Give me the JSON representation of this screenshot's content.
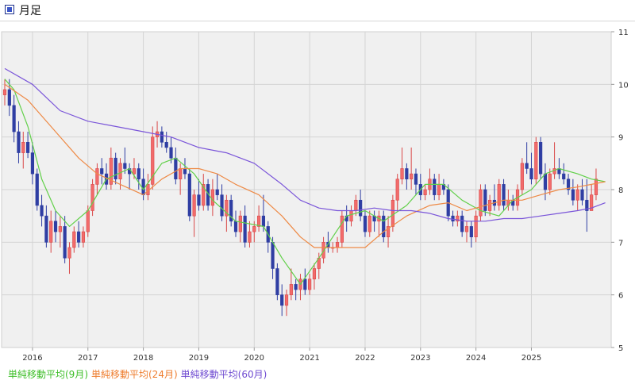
{
  "header": {
    "title": "月足",
    "icon": "chart-window-icon"
  },
  "colors": {
    "up": "#f26b6b",
    "up_border": "#d94848",
    "down": "#2f3ea3",
    "ma9": "#62d04a",
    "ma24": "#ee8a46",
    "ma60": "#7a55d9",
    "grid": "#d4d4d4",
    "plot_bg": "#f0f0f0"
  },
  "legend": [
    {
      "label": "単純移動平均(9月)",
      "color": "#3fbf2a"
    },
    {
      "label": "単純移動平均(24月)",
      "color": "#ee7d2e"
    },
    {
      "label": "単純移動平均(60月)",
      "color": "#6f4bd1"
    }
  ],
  "chart_data": {
    "type": "candlestick",
    "title": "月足",
    "ylim": [
      5,
      11
    ],
    "y_ticks": [
      5,
      6,
      7,
      8,
      9,
      10,
      11
    ],
    "y_axis_position": "right",
    "x_tick_labels": [
      "2016",
      "2017",
      "2018",
      "2019",
      "2020",
      "2021",
      "2022",
      "2023",
      "2024",
      "2025"
    ],
    "start_month": "2015-07",
    "grid": true,
    "candles": [
      [
        9.8,
        10.1,
        9.6,
        9.9
      ],
      [
        9.9,
        10.1,
        9.4,
        9.6
      ],
      [
        9.6,
        9.8,
        8.9,
        9.1
      ],
      [
        9.1,
        9.3,
        8.5,
        8.7
      ],
      [
        8.7,
        9.1,
        8.4,
        8.9
      ],
      [
        8.9,
        9.1,
        8.6,
        8.7
      ],
      [
        8.7,
        8.9,
        8.1,
        8.3
      ],
      [
        8.3,
        8.4,
        7.6,
        7.7
      ],
      [
        7.7,
        7.9,
        7.3,
        7.5
      ],
      [
        7.5,
        7.7,
        6.9,
        7.0
      ],
      [
        7.0,
        7.6,
        6.8,
        7.4
      ],
      [
        7.4,
        7.6,
        7.0,
        7.2
      ],
      [
        7.2,
        7.5,
        6.9,
        7.3
      ],
      [
        7.3,
        7.5,
        6.6,
        6.7
      ],
      [
        6.7,
        7.0,
        6.4,
        6.9
      ],
      [
        6.9,
        7.3,
        6.8,
        7.2
      ],
      [
        7.2,
        7.4,
        6.9,
        7.0
      ],
      [
        7.0,
        7.3,
        6.9,
        7.2
      ],
      [
        7.2,
        7.7,
        7.1,
        7.6
      ],
      [
        7.6,
        8.2,
        7.5,
        8.1
      ],
      [
        8.1,
        8.5,
        7.9,
        8.4
      ],
      [
        8.4,
        8.6,
        8.1,
        8.3
      ],
      [
        8.3,
        8.5,
        8.0,
        8.1
      ],
      [
        8.1,
        8.8,
        8.0,
        8.6
      ],
      [
        8.6,
        8.7,
        8.1,
        8.2
      ],
      [
        8.2,
        8.6,
        8.0,
        8.5
      ],
      [
        8.5,
        8.8,
        8.3,
        8.4
      ],
      [
        8.4,
        8.5,
        8.0,
        8.3
      ],
      [
        8.3,
        8.6,
        8.2,
        8.4
      ],
      [
        8.4,
        8.5,
        8.0,
        8.2
      ],
      [
        8.2,
        8.4,
        7.8,
        7.9
      ],
      [
        7.9,
        8.3,
        7.8,
        8.1
      ],
      [
        8.1,
        9.2,
        8.0,
        9.0
      ],
      [
        9.0,
        9.3,
        8.8,
        9.1
      ],
      [
        9.1,
        9.2,
        8.8,
        8.9
      ],
      [
        8.9,
        9.1,
        8.7,
        8.8
      ],
      [
        8.8,
        9.0,
        8.5,
        8.6
      ],
      [
        8.6,
        8.8,
        8.1,
        8.2
      ],
      [
        8.2,
        8.5,
        7.9,
        8.4
      ],
      [
        8.4,
        8.6,
        8.2,
        8.3
      ],
      [
        8.3,
        8.4,
        7.4,
        7.5
      ],
      [
        7.5,
        8.0,
        7.1,
        7.9
      ],
      [
        7.9,
        8.2,
        7.6,
        7.7
      ],
      [
        7.7,
        8.3,
        7.6,
        8.1
      ],
      [
        8.1,
        8.2,
        7.6,
        7.7
      ],
      [
        7.7,
        8.2,
        7.5,
        8.0
      ],
      [
        8.0,
        8.3,
        7.8,
        7.9
      ],
      [
        7.9,
        8.1,
        7.4,
        7.5
      ],
      [
        7.5,
        7.9,
        7.2,
        7.8
      ],
      [
        7.8,
        7.9,
        7.3,
        7.4
      ],
      [
        7.4,
        7.6,
        7.1,
        7.2
      ],
      [
        7.2,
        7.6,
        7.0,
        7.5
      ],
      [
        7.5,
        7.7,
        6.9,
        7.0
      ],
      [
        7.0,
        7.4,
        6.9,
        7.2
      ],
      [
        7.2,
        7.4,
        7.0,
        7.3
      ],
      [
        7.3,
        7.7,
        7.2,
        7.5
      ],
      [
        7.5,
        7.9,
        7.2,
        7.3
      ],
      [
        7.3,
        7.4,
        6.8,
        7.0
      ],
      [
        7.0,
        7.1,
        6.3,
        6.5
      ],
      [
        6.5,
        6.6,
        5.9,
        6.0
      ],
      [
        6.0,
        6.2,
        5.6,
        5.8
      ],
      [
        5.8,
        6.1,
        5.6,
        6.0
      ],
      [
        6.0,
        6.5,
        5.9,
        6.2
      ],
      [
        6.2,
        6.3,
        5.9,
        6.1
      ],
      [
        6.1,
        6.4,
        5.9,
        6.3
      ],
      [
        6.3,
        6.5,
        6.0,
        6.1
      ],
      [
        6.1,
        6.4,
        6.0,
        6.3
      ],
      [
        6.3,
        6.6,
        6.1,
        6.5
      ],
      [
        6.5,
        6.8,
        6.3,
        6.7
      ],
      [
        6.7,
        7.1,
        6.6,
        7.0
      ],
      [
        7.0,
        7.2,
        6.8,
        6.9
      ],
      [
        6.9,
        7.0,
        6.8,
        6.9
      ],
      [
        6.9,
        7.1,
        6.8,
        7.0
      ],
      [
        7.0,
        7.6,
        6.9,
        7.5
      ],
      [
        7.5,
        7.7,
        7.2,
        7.4
      ],
      [
        7.4,
        7.7,
        7.3,
        7.6
      ],
      [
        7.6,
        7.9,
        7.5,
        7.8
      ],
      [
        7.8,
        8.0,
        7.4,
        7.5
      ],
      [
        7.5,
        7.6,
        7.1,
        7.2
      ],
      [
        7.2,
        7.6,
        7.1,
        7.5
      ],
      [
        7.5,
        7.6,
        7.2,
        7.4
      ],
      [
        7.4,
        7.6,
        7.1,
        7.5
      ],
      [
        7.5,
        7.6,
        7.0,
        7.1
      ],
      [
        7.1,
        7.5,
        6.9,
        7.3
      ],
      [
        7.3,
        7.9,
        7.2,
        7.8
      ],
      [
        7.8,
        8.3,
        7.6,
        8.2
      ],
      [
        8.2,
        8.8,
        8.1,
        8.4
      ],
      [
        8.4,
        8.5,
        8.0,
        8.2
      ],
      [
        8.2,
        8.8,
        8.0,
        8.3
      ],
      [
        8.3,
        8.4,
        7.9,
        8.1
      ],
      [
        8.1,
        8.3,
        7.8,
        7.9
      ],
      [
        7.9,
        8.1,
        7.8,
        8.0
      ],
      [
        8.0,
        8.4,
        7.9,
        8.2
      ],
      [
        8.2,
        8.3,
        7.8,
        7.9
      ],
      [
        7.9,
        8.3,
        7.8,
        8.1
      ],
      [
        8.1,
        8.2,
        7.9,
        8.0
      ],
      [
        8.0,
        8.1,
        7.4,
        7.5
      ],
      [
        7.5,
        7.6,
        7.3,
        7.4
      ],
      [
        7.4,
        7.6,
        7.3,
        7.5
      ],
      [
        7.5,
        7.6,
        7.1,
        7.2
      ],
      [
        7.2,
        7.4,
        7.0,
        7.3
      ],
      [
        7.3,
        7.4,
        6.9,
        7.1
      ],
      [
        7.1,
        7.6,
        7.0,
        7.5
      ],
      [
        7.5,
        8.1,
        7.4,
        8.0
      ],
      [
        8.0,
        8.1,
        7.5,
        7.6
      ],
      [
        7.6,
        7.9,
        7.5,
        7.8
      ],
      [
        7.8,
        8.1,
        7.6,
        7.7
      ],
      [
        7.7,
        8.2,
        7.6,
        8.1
      ],
      [
        8.1,
        8.2,
        7.6,
        7.7
      ],
      [
        7.7,
        8.0,
        7.6,
        7.8
      ],
      [
        7.8,
        7.9,
        7.6,
        7.7
      ],
      [
        7.7,
        8.1,
        7.6,
        8.0
      ],
      [
        8.0,
        8.6,
        7.9,
        8.5
      ],
      [
        8.5,
        8.9,
        8.3,
        8.4
      ],
      [
        8.4,
        8.7,
        8.1,
        8.2
      ],
      [
        8.2,
        9.0,
        8.1,
        8.9
      ],
      [
        8.9,
        9.0,
        8.2,
        8.3
      ],
      [
        8.3,
        8.5,
        7.8,
        8.0
      ],
      [
        8.0,
        8.4,
        7.9,
        8.3
      ],
      [
        8.3,
        8.9,
        8.2,
        8.4
      ],
      [
        8.4,
        8.6,
        8.2,
        8.3
      ],
      [
        8.3,
        8.5,
        8.1,
        8.2
      ],
      [
        8.2,
        8.3,
        7.9,
        8.0
      ],
      [
        8.0,
        8.2,
        7.7,
        7.8
      ],
      [
        7.8,
        8.1,
        7.6,
        8.0
      ],
      [
        8.0,
        8.2,
        7.7,
        7.8
      ],
      [
        7.8,
        8.2,
        7.2,
        7.6
      ],
      [
        7.6,
        8.1,
        7.6,
        7.9
      ],
      [
        7.9,
        8.4,
        7.8,
        8.2
      ]
    ],
    "series": [
      {
        "name": "単純移動平均(9月)",
        "color": "#62d04a",
        "x": [
          0,
          2,
          5,
          8,
          11,
          14,
          18,
          22,
          27,
          30,
          34,
          37,
          41,
          45,
          50,
          56,
          60,
          64,
          68,
          71,
          74,
          78,
          82,
          87,
          91,
          95,
          99,
          103,
          107,
          110,
          114,
          117,
          120,
          124,
          127,
          130
        ],
        "y": [
          10.1,
          9.9,
          9.2,
          8.2,
          7.6,
          7.3,
          7.6,
          8.2,
          8.4,
          8.0,
          8.5,
          8.6,
          8.3,
          7.8,
          7.4,
          7.3,
          6.7,
          6.2,
          6.7,
          7.1,
          7.5,
          7.6,
          7.4,
          7.7,
          8.1,
          8.1,
          7.8,
          7.6,
          7.5,
          7.8,
          8.0,
          8.3,
          8.4,
          8.3,
          8.2,
          8.15
        ]
      },
      {
        "name": "単純移動平均(24月)",
        "color": "#ee8a46",
        "x": [
          0,
          5,
          10,
          16,
          20,
          25,
          30,
          34,
          38,
          42,
          46,
          50,
          55,
          60,
          64,
          67,
          70,
          74,
          78,
          82,
          87,
          92,
          96,
          100,
          104,
          108,
          112,
          116,
          120,
          124,
          127,
          130
        ],
        "y": [
          10.0,
          9.7,
          9.2,
          8.6,
          8.3,
          8.1,
          7.9,
          8.2,
          8.4,
          8.4,
          8.3,
          8.1,
          7.9,
          7.5,
          7.1,
          6.9,
          6.9,
          6.9,
          6.9,
          7.2,
          7.5,
          7.7,
          7.75,
          7.6,
          7.7,
          7.8,
          7.8,
          7.9,
          8.0,
          8.05,
          8.1,
          8.15
        ]
      },
      {
        "name": "単純移動平均(60月)",
        "color": "#7a55d9",
        "x": [
          0,
          6,
          12,
          18,
          24,
          30,
          36,
          42,
          48,
          54,
          60,
          64,
          68,
          72,
          76,
          80,
          84,
          88,
          92,
          96,
          100,
          104,
          108,
          112,
          116,
          120,
          124,
          127,
          130
        ],
        "y": [
          10.3,
          10.0,
          9.5,
          9.3,
          9.2,
          9.1,
          9.0,
          8.8,
          8.7,
          8.5,
          8.1,
          7.8,
          7.65,
          7.6,
          7.6,
          7.65,
          7.6,
          7.6,
          7.55,
          7.45,
          7.4,
          7.4,
          7.45,
          7.45,
          7.5,
          7.55,
          7.6,
          7.65,
          7.75
        ]
      }
    ]
  }
}
